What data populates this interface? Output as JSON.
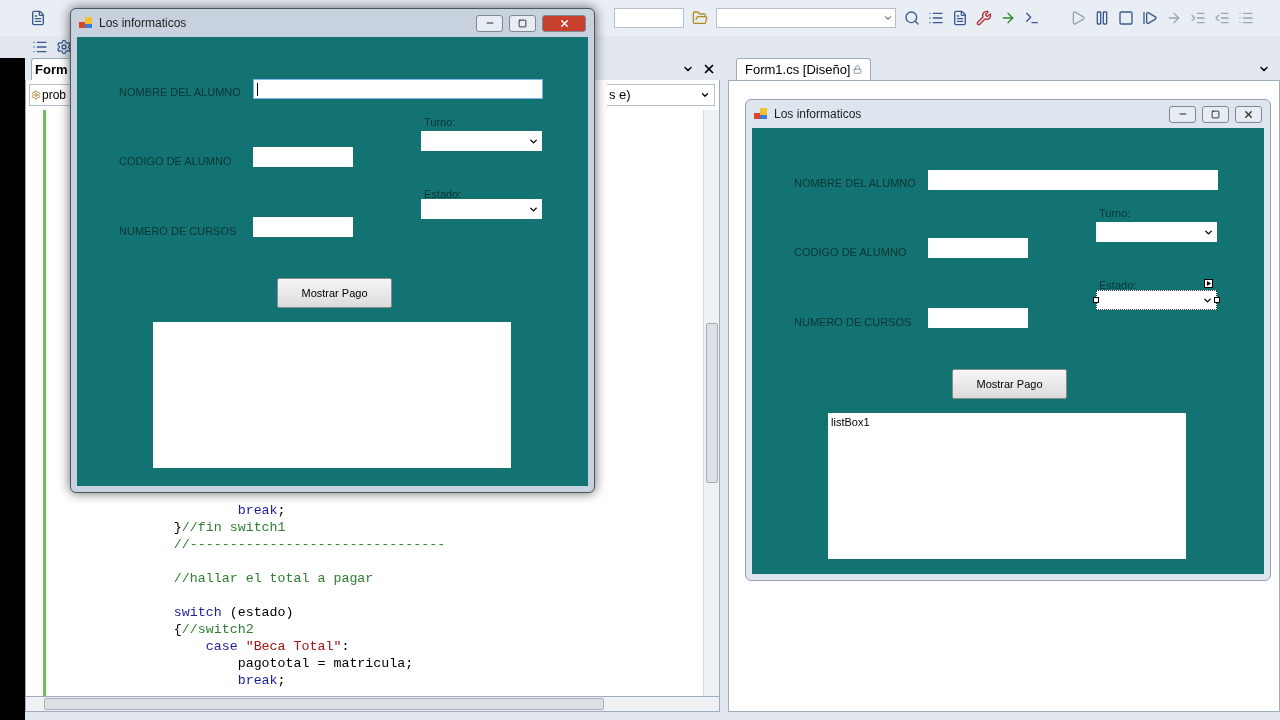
{
  "code_editor": {
    "tab": "Form",
    "type_dropdown": "prob",
    "member_dropdown": "s e)",
    "lines": [
      {
        "gap_before": false,
        "segments": [
          {
            "kind": "keyword",
            "text": "                break"
          },
          {
            "kind": "plain",
            "text": ";"
          }
        ]
      },
      {
        "gap_before": false,
        "segments": [
          {
            "kind": "plain",
            "text": "        }"
          },
          {
            "kind": "comment",
            "text": "//fin switch1"
          }
        ]
      },
      {
        "gap_before": false,
        "segments": [
          {
            "kind": "comment",
            "text": "        //--------------------------------"
          }
        ]
      },
      {
        "gap_before": true,
        "segments": [
          {
            "kind": "comment",
            "text": "        //hallar el total a pagar"
          }
        ]
      },
      {
        "gap_before": true,
        "segments": [
          {
            "kind": "keyword",
            "text": "        switch"
          },
          {
            "kind": "plain",
            "text": " (estado)"
          }
        ]
      },
      {
        "gap_before": false,
        "segments": [
          {
            "kind": "plain",
            "text": "        {"
          },
          {
            "kind": "comment",
            "text": "//switch2"
          }
        ]
      },
      {
        "gap_before": false,
        "segments": [
          {
            "kind": "keyword",
            "text": "            case"
          },
          {
            "kind": "string",
            "text": " \"Beca Total\""
          },
          {
            "kind": "plain",
            "text": ":"
          }
        ]
      },
      {
        "gap_before": false,
        "segments": [
          {
            "kind": "plain",
            "text": "                pagototal = matricula;"
          }
        ]
      },
      {
        "gap_before": false,
        "segments": [
          {
            "kind": "keyword",
            "text": "                break"
          },
          {
            "kind": "plain",
            "text": ";"
          }
        ]
      }
    ]
  },
  "designer": {
    "tab": "Form1.cs [Diseño]",
    "form": {
      "title": "Los informaticos",
      "active": false,
      "fields": [
        {
          "label": "NOMBRE DEL ALUMNO",
          "focused": false
        },
        {
          "label": "CODIGO DE ALUMNO",
          "focused": false
        },
        {
          "label": "NUMERO DE CURSOS",
          "focused": false
        }
      ],
      "combos": [
        {
          "label": "Turno:",
          "selected": false
        },
        {
          "label": "Estado:",
          "selected": true
        }
      ],
      "button": "Mostrar Pago",
      "listbox_items": [
        "listBox1"
      ]
    }
  },
  "running_form": {
    "title": "Los informaticos",
    "active": true,
    "fields": [
      {
        "label": "NOMBRE DEL ALUMNO",
        "focused": true
      },
      {
        "label": "CODIGO DE ALUMNO",
        "focused": false
      },
      {
        "label": "NUMERO DE CURSOS",
        "focused": false
      }
    ],
    "combos": [
      {
        "label": "Turno:",
        "selected": false
      },
      {
        "label": "Estado:",
        "selected": false
      }
    ],
    "button": "Mostrar Pago"
  }
}
